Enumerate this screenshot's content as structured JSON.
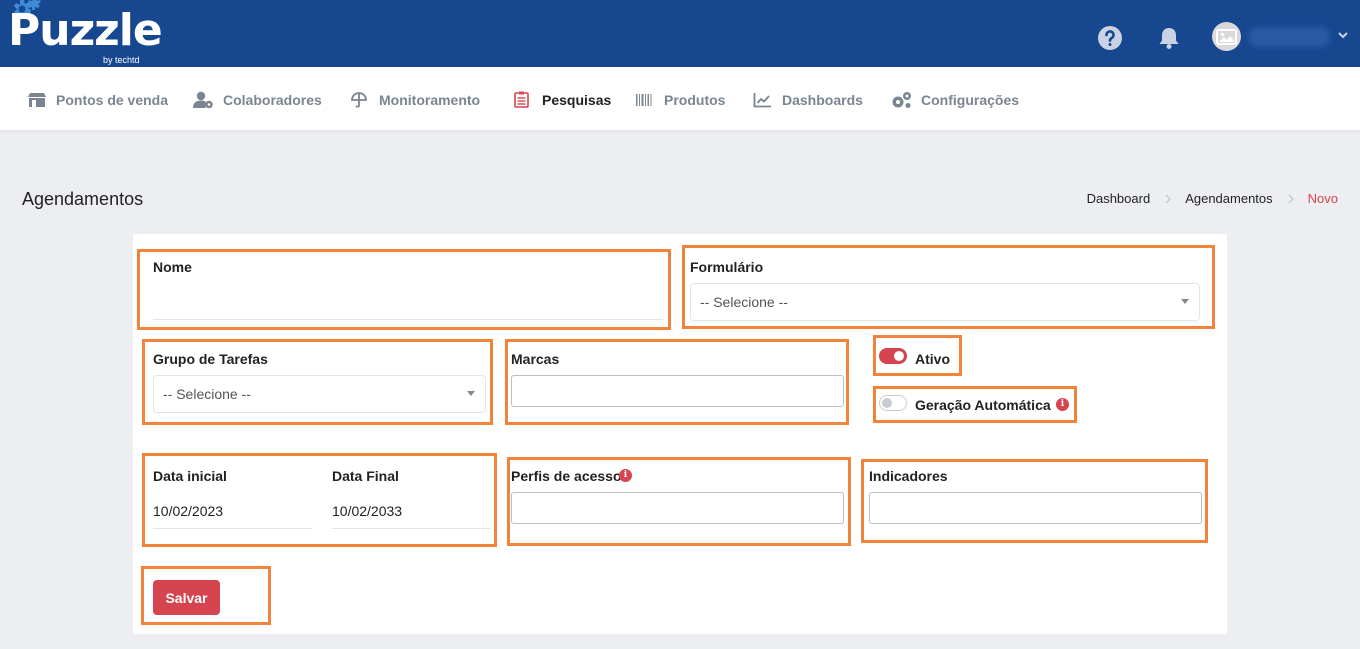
{
  "app": {
    "logo_text": "Puzzle",
    "logo_sub": "by techtd"
  },
  "nav": {
    "items": [
      {
        "label": "Pontos de venda",
        "icon": "store-icon"
      },
      {
        "label": "Colaboradores",
        "icon": "user-gear-icon"
      },
      {
        "label": "Monitoramento",
        "icon": "umbrella-icon"
      },
      {
        "label": "Pesquisas",
        "icon": "clipboard-list-icon",
        "active": true
      },
      {
        "label": "Produtos",
        "icon": "barcode-icon"
      },
      {
        "label": "Dashboards",
        "icon": "chart-line-icon"
      },
      {
        "label": "Configurações",
        "icon": "gears-icon"
      }
    ]
  },
  "page": {
    "title": "Agendamentos"
  },
  "breadcrumb": [
    "Dashboard",
    "Agendamentos",
    "Novo"
  ],
  "form": {
    "nome": {
      "label": "Nome",
      "value": ""
    },
    "formulario": {
      "label": "Formulário",
      "selected": "-- Selecione --"
    },
    "grupo_tarefas": {
      "label": "Grupo de Tarefas",
      "selected": "-- Selecione --"
    },
    "marcas": {
      "label": "Marcas",
      "value": ""
    },
    "ativo": {
      "label": "Ativo",
      "checked": true
    },
    "geracao_automatica": {
      "label": "Geração Automática",
      "checked": false
    },
    "data_inicial": {
      "label": "Data inicial",
      "value": "10/02/2023"
    },
    "data_final": {
      "label": "Data Final",
      "value": "10/02/2033"
    },
    "perfis_acesso": {
      "label": "Perfis de acesso",
      "value": ""
    },
    "indicadores": {
      "label": "Indicadores",
      "value": ""
    },
    "save_label": "Salvar"
  },
  "colors": {
    "header_bg": "#17478f",
    "accent": "#d5444f",
    "highlight": "#f0843a"
  }
}
